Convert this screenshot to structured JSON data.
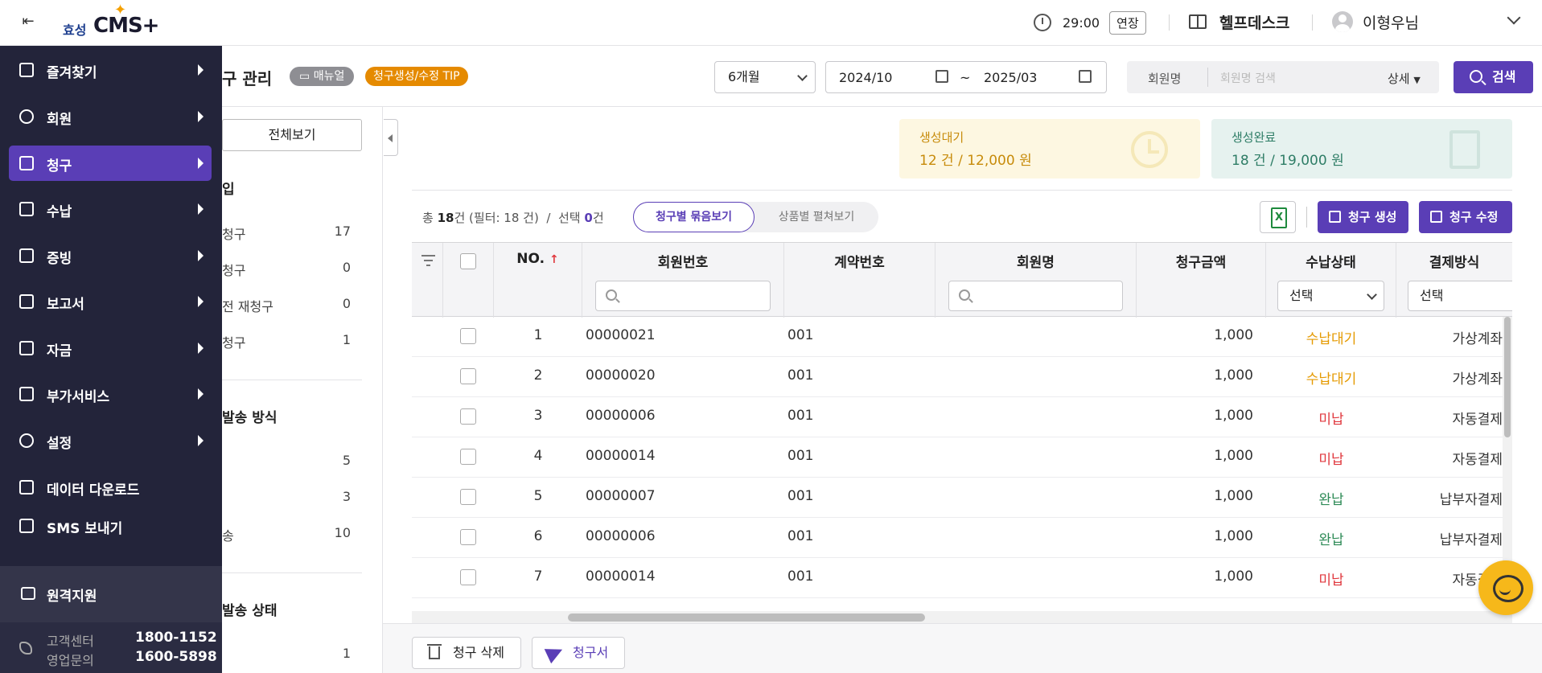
{
  "header": {
    "logo_prefix": "효성",
    "logo_main": "CMS+",
    "timer": "29:00",
    "extend_label": "연장",
    "helpdesk_label": "헬프데스크",
    "user_name": "이형우님"
  },
  "page": {
    "title_partial": "구 관리",
    "manual_badge": "매뉴얼",
    "tip_badge": "청구생성/수정 TIP",
    "period": "6개월",
    "date_from": "2024/10",
    "date_sep": "~",
    "date_to": "2025/03",
    "search_label": "회원명",
    "search_placeholder": "회원명 검색",
    "detail_label": "상세",
    "search_button": "검색"
  },
  "filter_panel": {
    "view_all": "전체보기",
    "section1_title": "입",
    "section1_items": [
      {
        "label": "청구",
        "count": "17"
      },
      {
        "label": "청구",
        "count": "0"
      },
      {
        "label": "전 재청구",
        "count": "0"
      },
      {
        "label": "청구",
        "count": "1"
      }
    ],
    "section2_title": "발송 방식",
    "section2_items": [
      {
        "label": "",
        "count": "5"
      },
      {
        "label": "",
        "count": "3"
      },
      {
        "label": "송",
        "count": "10"
      }
    ],
    "section3_title": "발송 상태",
    "section3_items": [
      {
        "label": "",
        "count": "1"
      }
    ]
  },
  "summary": {
    "wait_title": "생성대기",
    "wait_value": "12 건 / 12,000 원",
    "done_title": "생성완료",
    "done_value": "18 건 / 19,000 원"
  },
  "toolbar": {
    "total_prefix": "총",
    "total_count": "18",
    "total_suffix": "건 (필터: 18 건)",
    "slash": "/",
    "selected_prefix": "선택",
    "selected_count": "0",
    "selected_suffix": "건",
    "view_grouped": "청구별 묶음보기",
    "view_expanded": "상품별 펼쳐보기",
    "create_button": "청구 생성",
    "edit_button": "청구 수정"
  },
  "table": {
    "columns": {
      "no": "NO.",
      "member_no": "회원번호",
      "contract_no": "계약번호",
      "member_name": "회원명",
      "amount": "청구금액",
      "status": "수납상태",
      "payment": "결제방식"
    },
    "status_filter": "선택",
    "payment_filter": "선택",
    "rows": [
      {
        "no": "1",
        "member_no": "00000021",
        "contract_no": "001",
        "amount": "1,000",
        "status": "수납대기",
        "status_type": "wait",
        "payment": "가상계좌"
      },
      {
        "no": "2",
        "member_no": "00000020",
        "contract_no": "001",
        "amount": "1,000",
        "status": "수납대기",
        "status_type": "wait",
        "payment": "가상계좌"
      },
      {
        "no": "3",
        "member_no": "00000006",
        "contract_no": "001",
        "amount": "1,000",
        "status": "미납",
        "status_type": "unpaid",
        "payment": "자동결제"
      },
      {
        "no": "4",
        "member_no": "00000014",
        "contract_no": "001",
        "amount": "1,000",
        "status": "미납",
        "status_type": "unpaid",
        "payment": "자동결제"
      },
      {
        "no": "5",
        "member_no": "00000007",
        "contract_no": "001",
        "amount": "1,000",
        "status": "완납",
        "status_type": "done",
        "payment": "납부자결제"
      },
      {
        "no": "6",
        "member_no": "00000006",
        "contract_no": "001",
        "amount": "1,000",
        "status": "완납",
        "status_type": "done",
        "payment": "납부자결제"
      },
      {
        "no": "7",
        "member_no": "00000014",
        "contract_no": "001",
        "amount": "1,000",
        "status": "미납",
        "status_type": "unpaid",
        "payment": "자동결제"
      }
    ]
  },
  "bottom": {
    "delete_button": "청구 삭제",
    "invoice_button": "청구서"
  },
  "sidebar": {
    "items": [
      {
        "label": "즐겨찾기",
        "icon": "star-icon"
      },
      {
        "label": "회원",
        "icon": "person-icon"
      },
      {
        "label": "청구",
        "icon": "document-icon"
      },
      {
        "label": "수납",
        "icon": "calculator-icon"
      },
      {
        "label": "증빙",
        "icon": "store-icon"
      },
      {
        "label": "보고서",
        "icon": "report-icon"
      },
      {
        "label": "자금",
        "icon": "wallet-icon"
      },
      {
        "label": "부가서비스",
        "icon": "plus-icon"
      },
      {
        "label": "설정",
        "icon": "gear-icon"
      },
      {
        "label": "데이터 다운로드",
        "icon": "download-icon"
      },
      {
        "label": "SMS 보내기",
        "icon": "sms-icon"
      }
    ],
    "remote_label": "원격지원",
    "contact": [
      {
        "label": "고객센터",
        "number": "1800-1152"
      },
      {
        "label": "영업문의",
        "number": "1600-5898"
      }
    ]
  },
  "colors": {
    "accent": "#5a3eb6",
    "sidebar_bg": "#23243a",
    "wait": "#e59a00",
    "unpaid": "#e0383e",
    "done": "#2e8b57"
  }
}
